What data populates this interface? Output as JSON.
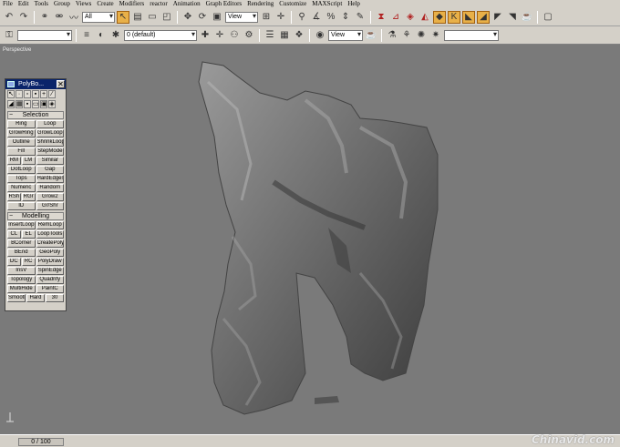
{
  "menu": [
    "File",
    "Edit",
    "Tools",
    "Group",
    "Views",
    "Create",
    "Modifiers",
    "reactor",
    "Animation",
    "Graph Editors",
    "Rendering",
    "Customize",
    "MAXScript",
    "Help"
  ],
  "toolbar1": {
    "selection_filter": "All",
    "ref_coord": "View"
  },
  "toolbar2": {
    "layer": "0 (default)",
    "viewport_shading": "View"
  },
  "viewport": {
    "label": "Perspective"
  },
  "polyboost": {
    "title": "PolyBo...",
    "close": "✕",
    "selection_header": "Selection",
    "selection_buttons": [
      "Ring",
      "Loop",
      "GrowRing",
      "GrowLoop",
      "Outline",
      "ShrinkLoop",
      "Fill",
      "StepMode",
      "RM",
      "LM",
      "Similar",
      "DotLoop",
      "Gap",
      "Tops",
      "HardEdges",
      "Numeric",
      "Random",
      "RSh",
      "RGr",
      "Grow2",
      "ID",
      "Gr/Shr"
    ],
    "modelling_header": "Modelling",
    "modelling_buttons": [
      "InsertLoop",
      "RemLoop",
      "CL",
      "EL",
      "LoopTools",
      "BCorner",
      "CreatePoly",
      "BEnd",
      "GeoPoly",
      "DC",
      "RC",
      "PolyDraw",
      "InsV",
      "SpinEdge",
      "Topology",
      "Quadrify",
      "MultiHide",
      "PaintC"
    ],
    "bottom_buttons": [
      "Smooth",
      "Hard",
      "30"
    ]
  },
  "status": {
    "time_slider": "0 / 100"
  },
  "watermark": "Chinavid.com"
}
